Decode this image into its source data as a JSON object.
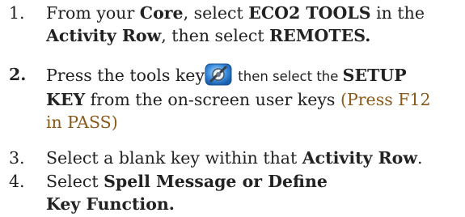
{
  "steps": [
    {
      "number": "1.",
      "parts": {
        "a": "From your ",
        "b": "Core",
        "c": ", select ",
        "d": "ECO2 TOOLS",
        "e": " in the ",
        "f": "Activity Row",
        "g": ", then select ",
        "h": "REMOTES."
      }
    },
    {
      "number": "2.",
      "parts": {
        "a": "Press the tools key",
        "b": " then select the ",
        "c": "SETUP KEY",
        "d": " from the on-screen user keys ",
        "e": "(Press F12 in PASS)"
      },
      "icon": "tools-key-icon"
    },
    {
      "number": "3.",
      "parts": {
        "a": "Select a blank key within that ",
        "b": "Activity Row",
        "c": "."
      }
    },
    {
      "number": "4.",
      "parts": {
        "a": "Select ",
        "b": "Spell Message or Define Key Function."
      }
    }
  ],
  "colors": {
    "text": "#222222",
    "note": "#8a5a1a",
    "icon_blue": "#2a7fd4"
  }
}
